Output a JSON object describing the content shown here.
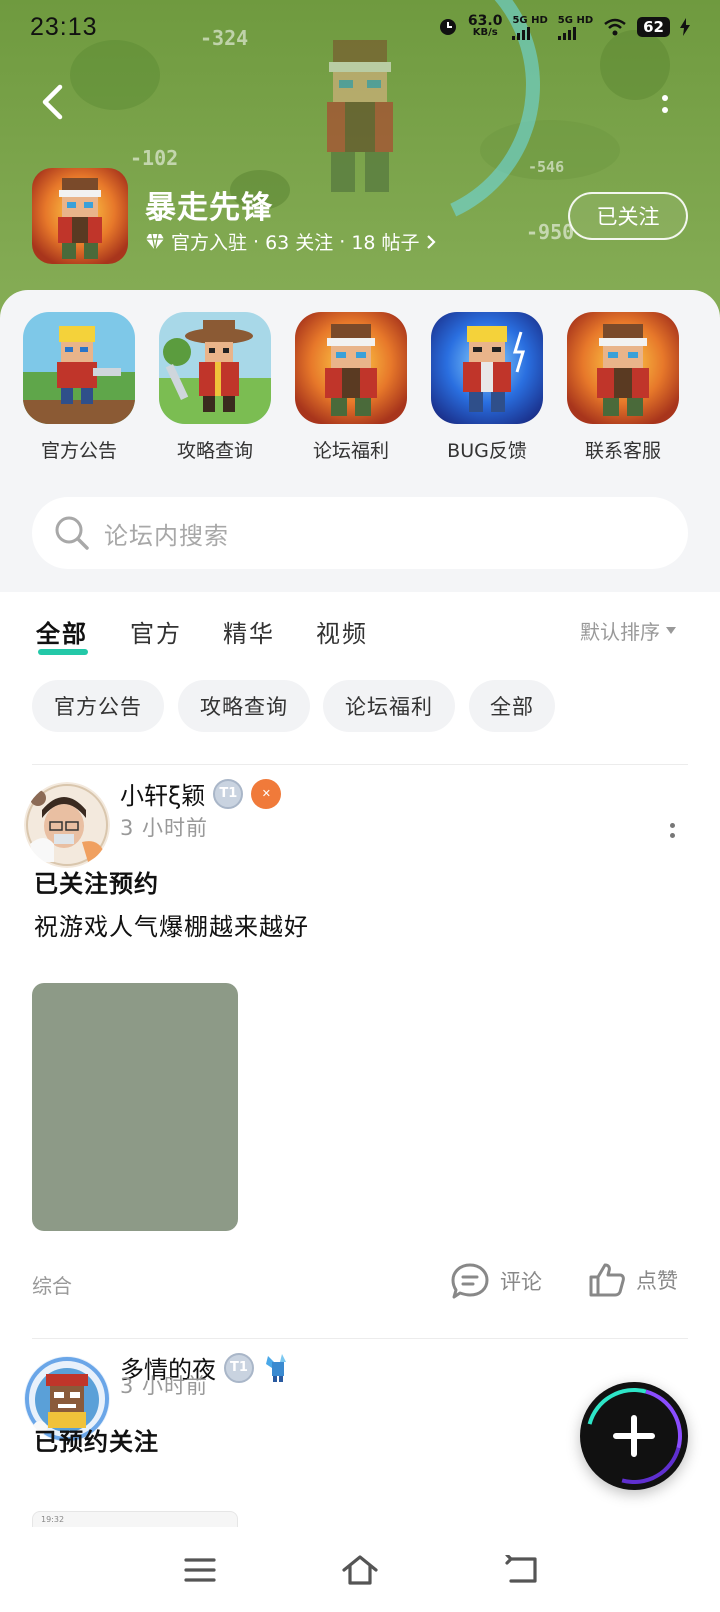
{
  "status_bar": {
    "time": "23:13",
    "net_speed": "63.0",
    "net_unit": "KB/s",
    "sim1": "5G HD",
    "sim2": "5G HD",
    "battery": "62"
  },
  "header": {
    "game_title": "暴走先锋",
    "meta": {
      "official": "官方入驻",
      "follows": "63 关注",
      "posts": "18 帖子"
    },
    "follow_label": "已关注",
    "background_numbers": [
      "-324",
      "-102",
      "-546",
      "-950"
    ]
  },
  "shortcuts": [
    {
      "label": "官方公告",
      "icon": "blonde-gunner-art"
    },
    {
      "label": "攻略查询",
      "icon": "cowboy-swordsman-art"
    },
    {
      "label": "论坛福利",
      "icon": "headband-hero-art"
    },
    {
      "label": "BUG反馈",
      "icon": "blue-hero-art"
    },
    {
      "label": "联系客服",
      "icon": "headband-hero-art"
    }
  ],
  "search": {
    "placeholder": "论坛内搜索"
  },
  "tabs": [
    {
      "label": "全部",
      "active": true
    },
    {
      "label": "官方",
      "active": false
    },
    {
      "label": "精华",
      "active": false
    },
    {
      "label": "视频",
      "active": false
    }
  ],
  "sort_label": "默认排序",
  "chips": [
    "官方公告",
    "攻略查询",
    "论坛福利",
    "全部"
  ],
  "posts": [
    {
      "author": "小轩ξ颖",
      "level_badge": "T1",
      "extra_badge": "orange-medal",
      "time": "3 小时前",
      "title": "已关注预约",
      "body": "祝游戏人气爆棚越来越好",
      "image_placeholder_color": "#8d9a87",
      "category": "综合",
      "comment_label": "评论",
      "like_label": "点赞"
    },
    {
      "author": "多情的夜",
      "level_badge": "T1",
      "extra_badge": "blue-figure",
      "time": "3 小时前",
      "title": "已预约关注",
      "thumb_text": "19:32"
    }
  ],
  "colors": {
    "accent": "#23c8a8",
    "header_green": "#7aa34a",
    "chip_bg": "#f2f3f5",
    "panel_bg": "#f4f5f7"
  }
}
